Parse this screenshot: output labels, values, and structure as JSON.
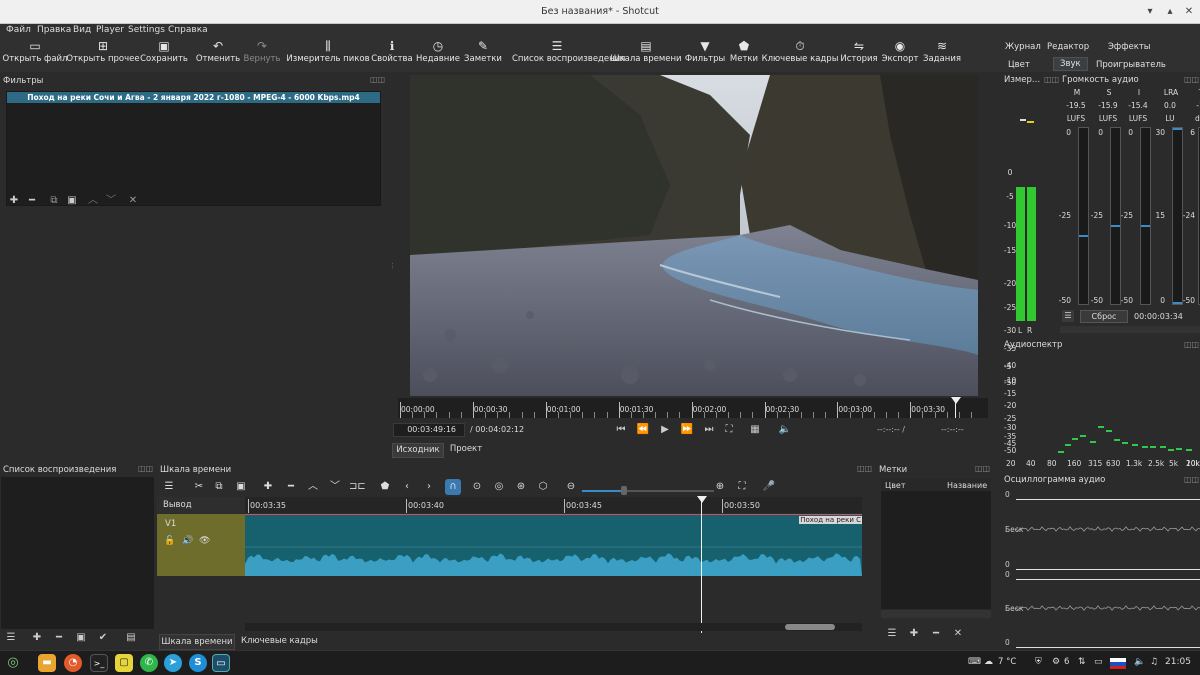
{
  "window": {
    "title": "Без названия* - Shotcut"
  },
  "menu": [
    "Файл",
    "Правка",
    "Вид",
    "Player",
    "Settings",
    "Справка"
  ],
  "toolbar": [
    {
      "label": "Открыть файл",
      "icon": "folder-open-icon",
      "glyph": "▭"
    },
    {
      "label": "Открыть прочее",
      "icon": "open-other-icon",
      "glyph": "⊞"
    },
    {
      "label": "Сохранить",
      "icon": "save-icon",
      "glyph": "▣"
    },
    {
      "label": "Отменить",
      "icon": "undo-icon",
      "glyph": "↶"
    },
    {
      "label": "Вернуть",
      "icon": "redo-icon",
      "glyph": "↷"
    },
    {
      "label": "Измеритель пиков",
      "icon": "peak-meter-icon",
      "glyph": "⫼"
    },
    {
      "label": "Свойства",
      "icon": "info-icon",
      "glyph": "ℹ"
    },
    {
      "label": "Недавние",
      "icon": "clock-icon",
      "glyph": "◷"
    },
    {
      "label": "Заметки",
      "icon": "notes-icon",
      "glyph": "✎"
    },
    {
      "label": "Список воспроизведения",
      "icon": "playlist-icon",
      "glyph": "☰"
    },
    {
      "label": "Шкала времени",
      "icon": "timeline-icon",
      "glyph": "▤"
    },
    {
      "label": "Фильтры",
      "icon": "filter-icon",
      "glyph": "▼"
    },
    {
      "label": "Метки",
      "icon": "marker-icon",
      "glyph": "⬟"
    },
    {
      "label": "Ключевые кадры",
      "icon": "stopwatch-icon",
      "glyph": "⏱"
    },
    {
      "label": "История",
      "icon": "history-icon",
      "glyph": "⇋"
    },
    {
      "label": "Экспорт",
      "icon": "export-icon",
      "glyph": "◉"
    },
    {
      "label": "Задания",
      "icon": "jobs-icon",
      "glyph": "≋"
    }
  ],
  "layouts": {
    "row1": [
      "Журнал",
      "Редактор",
      "Эффекты"
    ],
    "row2": [
      "Цвет",
      "Звук",
      "Проигрыватель"
    ],
    "active": "Звук"
  },
  "filters": {
    "title": "Фильтры",
    "clip_name": "Поход на реки Сочи и Агва - 2 января 2022 г-1080 - MPEG-4 - 6000 Kbps.mp4"
  },
  "player": {
    "ruler": [
      "00:00:00",
      "00:00:30",
      "00:01:00",
      "00:01:30",
      "00:02:00",
      "00:02:30",
      "00:03:00",
      "00:03:30"
    ],
    "current_time": "00:03:49:16",
    "total_time": "/ 00:04:02:12",
    "in_point": "--:--:-- /",
    "out_point": "--:--:--",
    "tabs": [
      "Исходник",
      "Проект"
    ]
  },
  "peak_meter": {
    "title": "Измер...",
    "scale": [
      "0",
      "-5",
      "-10",
      "-15",
      "-20",
      "-25",
      "-30",
      "-35",
      "-40",
      "-50"
    ],
    "channels": [
      "L",
      "R"
    ],
    "level_db": -18
  },
  "loudness": {
    "title": "Громкость аудио",
    "columns": [
      "M",
      "S",
      "I",
      "LRA",
      "T"
    ],
    "values": [
      "-19.5",
      "-15.9",
      "-15.4",
      "0.0",
      "-1"
    ],
    "units": [
      "LUFS",
      "LUFS",
      "LUFS",
      "LU",
      "dB"
    ],
    "top": [
      "0",
      "0",
      "0",
      "30",
      "6"
    ],
    "mid": [
      "-25",
      "-25",
      "-25",
      "15",
      "-24"
    ],
    "bottom": [
      "-50",
      "-50",
      "-50",
      "0",
      "-50"
    ],
    "reset": "Сброс",
    "time": "00:00:03:34"
  },
  "spectrum": {
    "title": "Аудиоспектр",
    "y": [
      "-5",
      "-15",
      "-25",
      "-35",
      "-50"
    ],
    "y2": [
      "-10",
      "-20",
      "-30",
      "-45"
    ],
    "x": [
      "20",
      "40",
      "80",
      "160",
      "315",
      "630",
      "1.3k",
      "2.5k",
      "5k",
      "10k",
      "20k"
    ]
  },
  "playlist": {
    "title": "Список воспроизведения"
  },
  "timeline": {
    "title": "Шкала времени",
    "output_label": "Вывод",
    "track": "V1",
    "ruler": [
      "00:03:35",
      "00:03:40",
      "00:03:45",
      "00:03:50"
    ],
    "clip_label": "Поход на реки С",
    "tabs": [
      "Шкала времени",
      "Ключевые кадры"
    ]
  },
  "markers": {
    "title": "Метки",
    "col_color": "Цвет",
    "col_name": "Название"
  },
  "waveform": {
    "title": "Осциллограмма аудио",
    "labels": [
      "0",
      "Беск",
      "0",
      "0",
      "Беск",
      "0"
    ]
  },
  "taskbar": {
    "weather": "7 °C",
    "count": "6",
    "clock": "21:05"
  }
}
